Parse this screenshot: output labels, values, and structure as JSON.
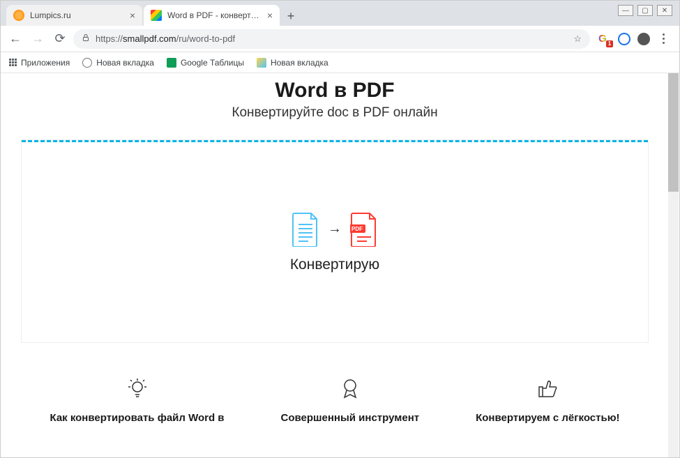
{
  "window": {
    "minimize": "—",
    "maximize": "▢",
    "close": "✕"
  },
  "tabs": [
    {
      "title": "Lumpics.ru",
      "active": false
    },
    {
      "title": "Word в PDF - конвертируйте DO",
      "active": true
    }
  ],
  "address": {
    "scheme": "https://",
    "host": "smallpdf.com",
    "path": "/ru/word-to-pdf"
  },
  "extensions": {
    "badge": "1"
  },
  "bookmarks": {
    "apps": "Приложения",
    "items": [
      {
        "label": "Новая вкладка"
      },
      {
        "label": "Google Таблицы"
      },
      {
        "label": "Новая вкладка"
      }
    ]
  },
  "page": {
    "title": "Word в PDF",
    "subtitle": "Конвертируйте doc в PDF онлайн",
    "converting_label": "Конвертирую",
    "pdf_badge": "PDF"
  },
  "features": [
    {
      "title": "Как конвертировать файл Word в"
    },
    {
      "title": "Совершенный инструмент"
    },
    {
      "title": "Конвертируем с лёгкостью!"
    }
  ]
}
